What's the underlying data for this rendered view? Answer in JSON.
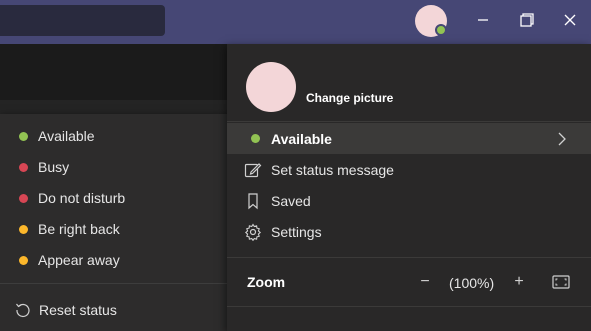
{
  "titlebar": {
    "background": "#464775",
    "presence_color": "#92c353",
    "window_controls": [
      "minimize-icon",
      "restore-icon",
      "close-icon"
    ]
  },
  "status_menu": {
    "items": [
      {
        "label": "Available",
        "color": "#92c353"
      },
      {
        "label": "Busy",
        "color": "#d74654"
      },
      {
        "label": "Do not disturb",
        "color": "#d74654"
      },
      {
        "label": "Be right back",
        "color": "#fcb72b"
      },
      {
        "label": "Appear away",
        "color": "#fcb72b"
      }
    ],
    "reset_label": "Reset status"
  },
  "profile": {
    "change_picture": "Change picture",
    "current_status": "Available",
    "set_status_message": "Set status message",
    "saved": "Saved",
    "settings": "Settings",
    "zoom_label": "Zoom",
    "zoom_value": "(100%)",
    "zoom_out_symbol": "−",
    "zoom_in_symbol": "+"
  }
}
